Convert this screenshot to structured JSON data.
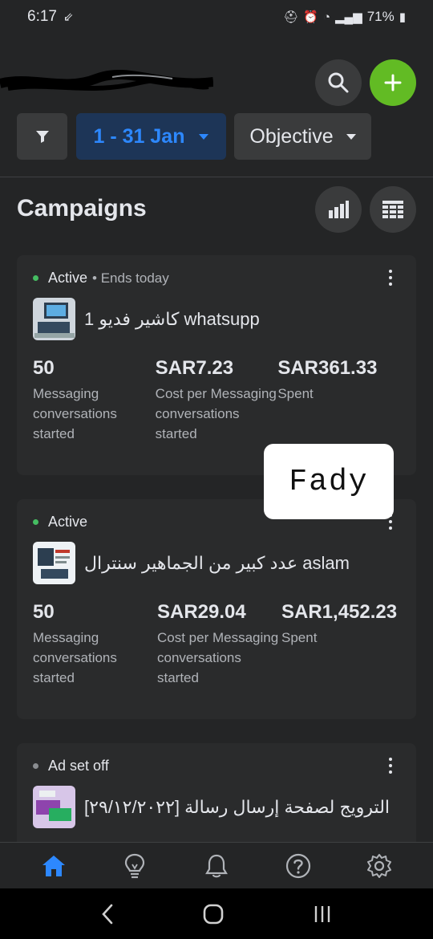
{
  "status_bar": {
    "time": "6:17",
    "battery": "71%"
  },
  "header": {},
  "filters": {
    "date_range": "1 - 31 Jan",
    "objective": "Objective"
  },
  "campaigns_title": "Campaigns",
  "campaigns": [
    {
      "status": "Active",
      "status_extra": "• Ends today",
      "name": "كاشير فديو 1 whatsupp",
      "metrics": [
        {
          "value": "50",
          "label": "Messaging conversations started"
        },
        {
          "value": "SAR7.23",
          "label": "Cost per Messaging conversations started"
        },
        {
          "value": "SAR361.33",
          "label": "Spent"
        }
      ]
    },
    {
      "status": "Active",
      "status_extra": "",
      "name": "عدد كبير من الجماهير سنترال aslam",
      "metrics": [
        {
          "value": "50",
          "label": "Messaging conversations started"
        },
        {
          "value": "SAR29.04",
          "label": "Cost per Messaging conversations started"
        },
        {
          "value": "SAR1,452.23",
          "label": "Spent"
        }
      ]
    },
    {
      "status": "Ad set off",
      "status_extra": "",
      "name": "الترويج لصفحة إرسال رسالة [٢٩/١٢/٢٠٢٢]",
      "metrics": []
    }
  ],
  "watermark_text": "Fady",
  "colors": {
    "accent_blue": "#2d88ff",
    "add_green": "#62bb24",
    "active_green": "#45bd62",
    "background": "#242526"
  },
  "nav_items": [
    "home-icon",
    "lightbulb-icon",
    "bell-icon",
    "help-icon",
    "settings-icon"
  ]
}
